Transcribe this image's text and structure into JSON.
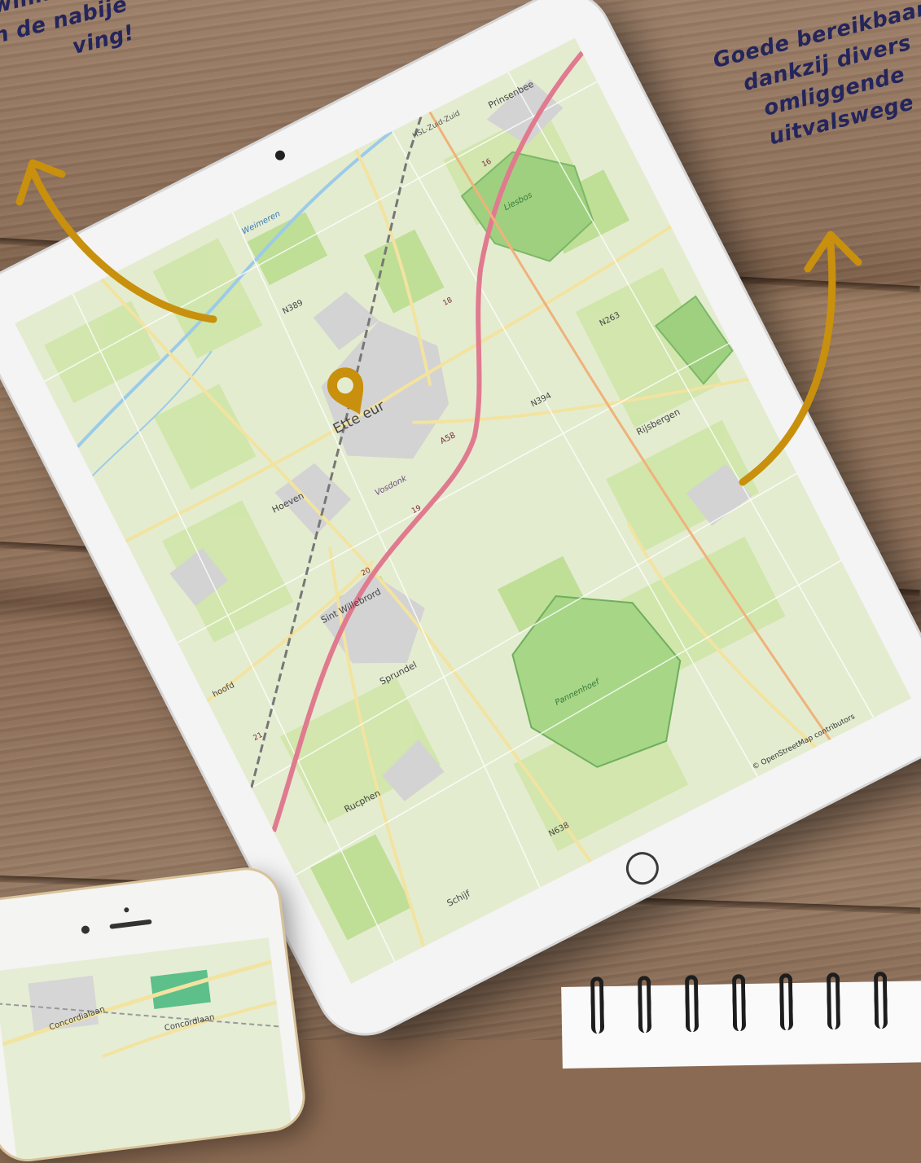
{
  "captions": {
    "left": "e winkelhart\n in de nabije\nving!",
    "right": "Goede bereikbaar\ndankzij divers\nomliggende\nuitvalswege"
  },
  "map": {
    "place_labels": [
      {
        "text": "Weimeren",
        "kind": "water"
      },
      {
        "text": "HSL-Zuid-Zuid",
        "kind": "rail"
      },
      {
        "text": "Prinsenbee",
        "kind": "town"
      },
      {
        "text": "N389",
        "kind": "road"
      },
      {
        "text": "Liesbos",
        "kind": "forest"
      },
      {
        "text": "16",
        "kind": "exit"
      },
      {
        "text": "18",
        "kind": "exit"
      },
      {
        "text": "Hoeven",
        "kind": "town"
      },
      {
        "text": "Ette   eur",
        "kind": "city"
      },
      {
        "text": "N394",
        "kind": "road"
      },
      {
        "text": "Vosdonk",
        "kind": "district"
      },
      {
        "text": "A58",
        "kind": "motorway"
      },
      {
        "text": "19",
        "kind": "exit"
      },
      {
        "text": "20",
        "kind": "exit"
      },
      {
        "text": "N263",
        "kind": "road"
      },
      {
        "text": "hoofd",
        "kind": "town"
      },
      {
        "text": "Sint Willebrord",
        "kind": "town"
      },
      {
        "text": "Rijsbergen",
        "kind": "town"
      },
      {
        "text": "21",
        "kind": "exit"
      },
      {
        "text": "Sprundel",
        "kind": "town"
      },
      {
        "text": "Rucphen",
        "kind": "town"
      },
      {
        "text": "Pannenhoef",
        "kind": "forest"
      },
      {
        "text": "N638",
        "kind": "road"
      },
      {
        "text": "Schijf",
        "kind": "town"
      }
    ],
    "attribution": "© OpenStreetMap contributors",
    "marker_color": "#c8900c",
    "motorway_color": "#e07a8f",
    "road_color": "#f2e3a0"
  },
  "phone_map": {
    "street_labels": [
      "Concordialaan",
      "Concordlaan"
    ]
  },
  "colors": {
    "caption": "#23255c",
    "arrow": "#c8900c"
  }
}
